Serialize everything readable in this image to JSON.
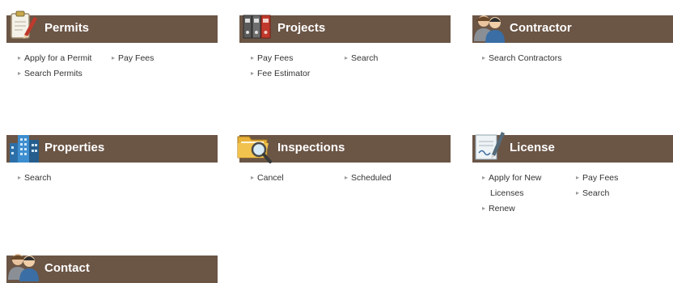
{
  "colors": {
    "header_bg": "#6b5545",
    "header_text": "#ffffff",
    "link_text": "#333333"
  },
  "permits": {
    "title": "Permits",
    "icon": "clipboard-pencil-icon",
    "links": [
      "Apply for a Permit",
      "Pay Fees",
      "Search Permits"
    ]
  },
  "projects": {
    "title": "Projects",
    "icon": "binders-icon",
    "links": [
      "Pay Fees",
      "Search",
      "Fee Estimator"
    ]
  },
  "contractor": {
    "title": "Contractor",
    "icon": "people-icon",
    "links": [
      "Search Contractors"
    ]
  },
  "properties": {
    "title": "Properties",
    "icon": "buildings-icon",
    "links": [
      "Search"
    ]
  },
  "inspections": {
    "title": "Inspections",
    "icon": "folder-magnifier-icon",
    "links": [
      "Cancel",
      "Scheduled"
    ]
  },
  "license": {
    "title": "License",
    "icon": "certificate-pen-icon",
    "links": [
      "Apply for New",
      "Licenses",
      "Pay Fees",
      "Search",
      "Renew"
    ]
  },
  "contact": {
    "title": "Contact",
    "icon": "people-icon"
  }
}
